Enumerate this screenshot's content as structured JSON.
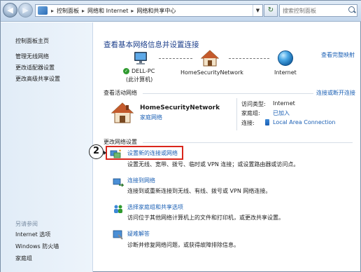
{
  "address_bar": {
    "crumbs": [
      "控制面板",
      "网络和 Internet",
      "网络和共享中心"
    ],
    "separator": "▸",
    "search_placeholder": "搜索控制面板"
  },
  "sidebar": {
    "home_label": "控制面板主页",
    "links": [
      "管理无线网络",
      "更改适配器设置",
      "更改高级共享设置"
    ],
    "see_also_heading": "另请参阅",
    "see_also": [
      "Internet 选项",
      "Windows 防火墙",
      "家庭组"
    ]
  },
  "main": {
    "title": "查看基本网络信息并设置连接",
    "full_map_link": "查看完整映射",
    "network_map": {
      "computer_name": "DELL-PC",
      "computer_sub": "(此计算机)",
      "network_name": "HomeSecurityNetwork",
      "internet_label": "Internet"
    },
    "active_networks": {
      "heading": "查看活动网络",
      "connect_link": "连接或断开连接",
      "network_name": "HomeSecurityNetwork",
      "network_type": "家庭网络",
      "access_type_label": "访问类型:",
      "access_type_value": "Internet",
      "homegroup_label": "家庭组:",
      "homegroup_value": "已加入",
      "connections_label": "连接:",
      "connections_value": "Local Area Connection"
    },
    "change_settings": {
      "heading": "更改网络设置",
      "tasks": [
        {
          "link": "设置新的连接或网络",
          "desc": "设置无线、宽带、拨号、临时或 VPN 连接；或设置路由器或访问点。"
        },
        {
          "link": "连接到网络",
          "desc": "连接到或重新连接到无线、有线、拨号或 VPN 网络连接。"
        },
        {
          "link": "选择家庭组和共享选项",
          "desc": "访问位于其他网络计算机上的文件和打印机，或更改共享设置。"
        },
        {
          "link": "疑难解答",
          "desc": "诊断并修复网络问题，或获得故障排除信息。"
        }
      ]
    }
  },
  "annotation": {
    "step_number": "2"
  },
  "colors": {
    "link": "#1a5fb4",
    "title": "#1c3f8b",
    "highlight_box": "#d9261c"
  },
  "icons": [
    "back-arrow-icon",
    "forward-arrow-icon",
    "control-panel-icon",
    "refresh-icon",
    "search-icon",
    "computer-icon",
    "house-icon",
    "globe-icon",
    "connection-icon",
    "network-setup-icon",
    "connect-icon",
    "homegroup-icon",
    "troubleshoot-icon"
  ]
}
